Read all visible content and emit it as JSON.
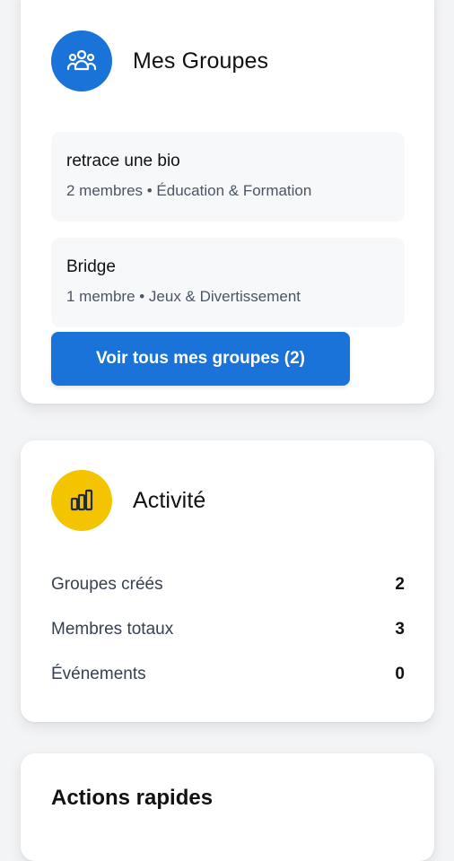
{
  "groups_card": {
    "title": "Mes Groupes",
    "icon": "users-icon",
    "accent": "#1a73d9",
    "items": [
      {
        "name": "retrace une bio",
        "meta": "2 membres • Éducation & Formation"
      },
      {
        "name": "Bridge",
        "meta": "1 membre • Jeux & Divertissement"
      }
    ],
    "view_all_label": "Voir tous mes groupes (2)"
  },
  "activity_card": {
    "title": "Activité",
    "icon": "bar-chart-icon",
    "accent": "#f5c400",
    "stats": [
      {
        "label": "Groupes créés",
        "value": "2"
      },
      {
        "label": "Membres totaux",
        "value": "3"
      },
      {
        "label": "Événements",
        "value": "0"
      }
    ]
  },
  "actions_card": {
    "title": "Actions rapides"
  }
}
